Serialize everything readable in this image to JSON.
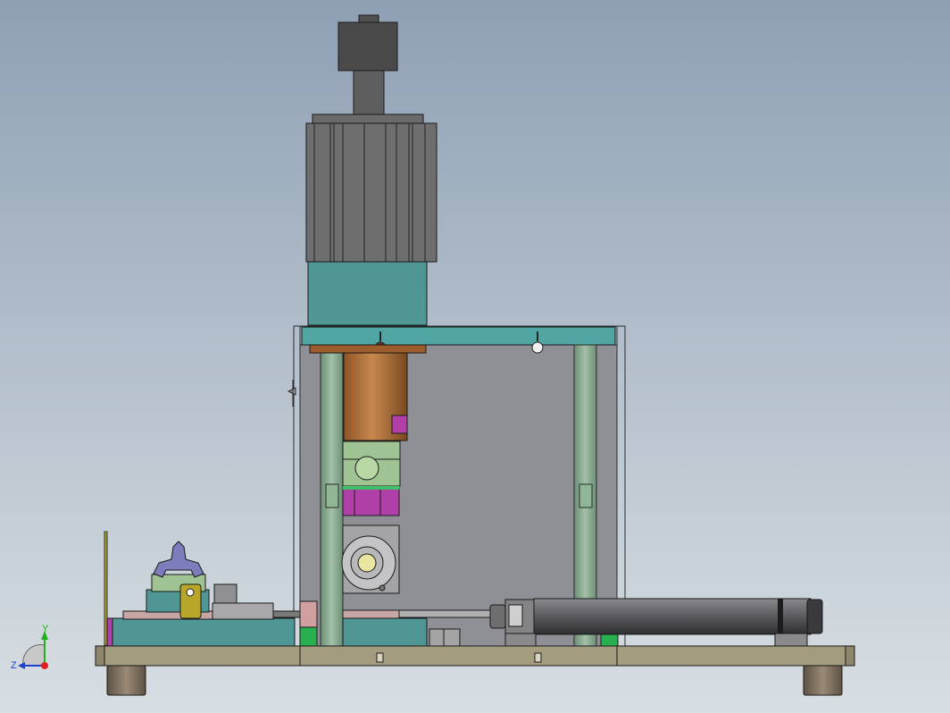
{
  "viewport": {
    "background_top": "#8fa0b4",
    "background_bottom": "#d8dfe3"
  },
  "triad": {
    "axis_y_label": "Y",
    "axis_z_label": "Z",
    "axis_y_color": "#20b020",
    "axis_z_color": "#2040d0",
    "axis_x_color": "#e02020"
  },
  "model": {
    "motor_color": "#6e6e6e",
    "frame_plate_color": "#4fa6a2",
    "guard_color": "#8e9096",
    "column_color": "#7f9f86",
    "reducer_color": "#b06f3a",
    "accent_magenta": "#b040a8",
    "base_color": "#a49c7e",
    "foot_color": "#7a6b5a",
    "cylinder_color": "#58585c",
    "clamp_color": "#7d7cbc"
  }
}
